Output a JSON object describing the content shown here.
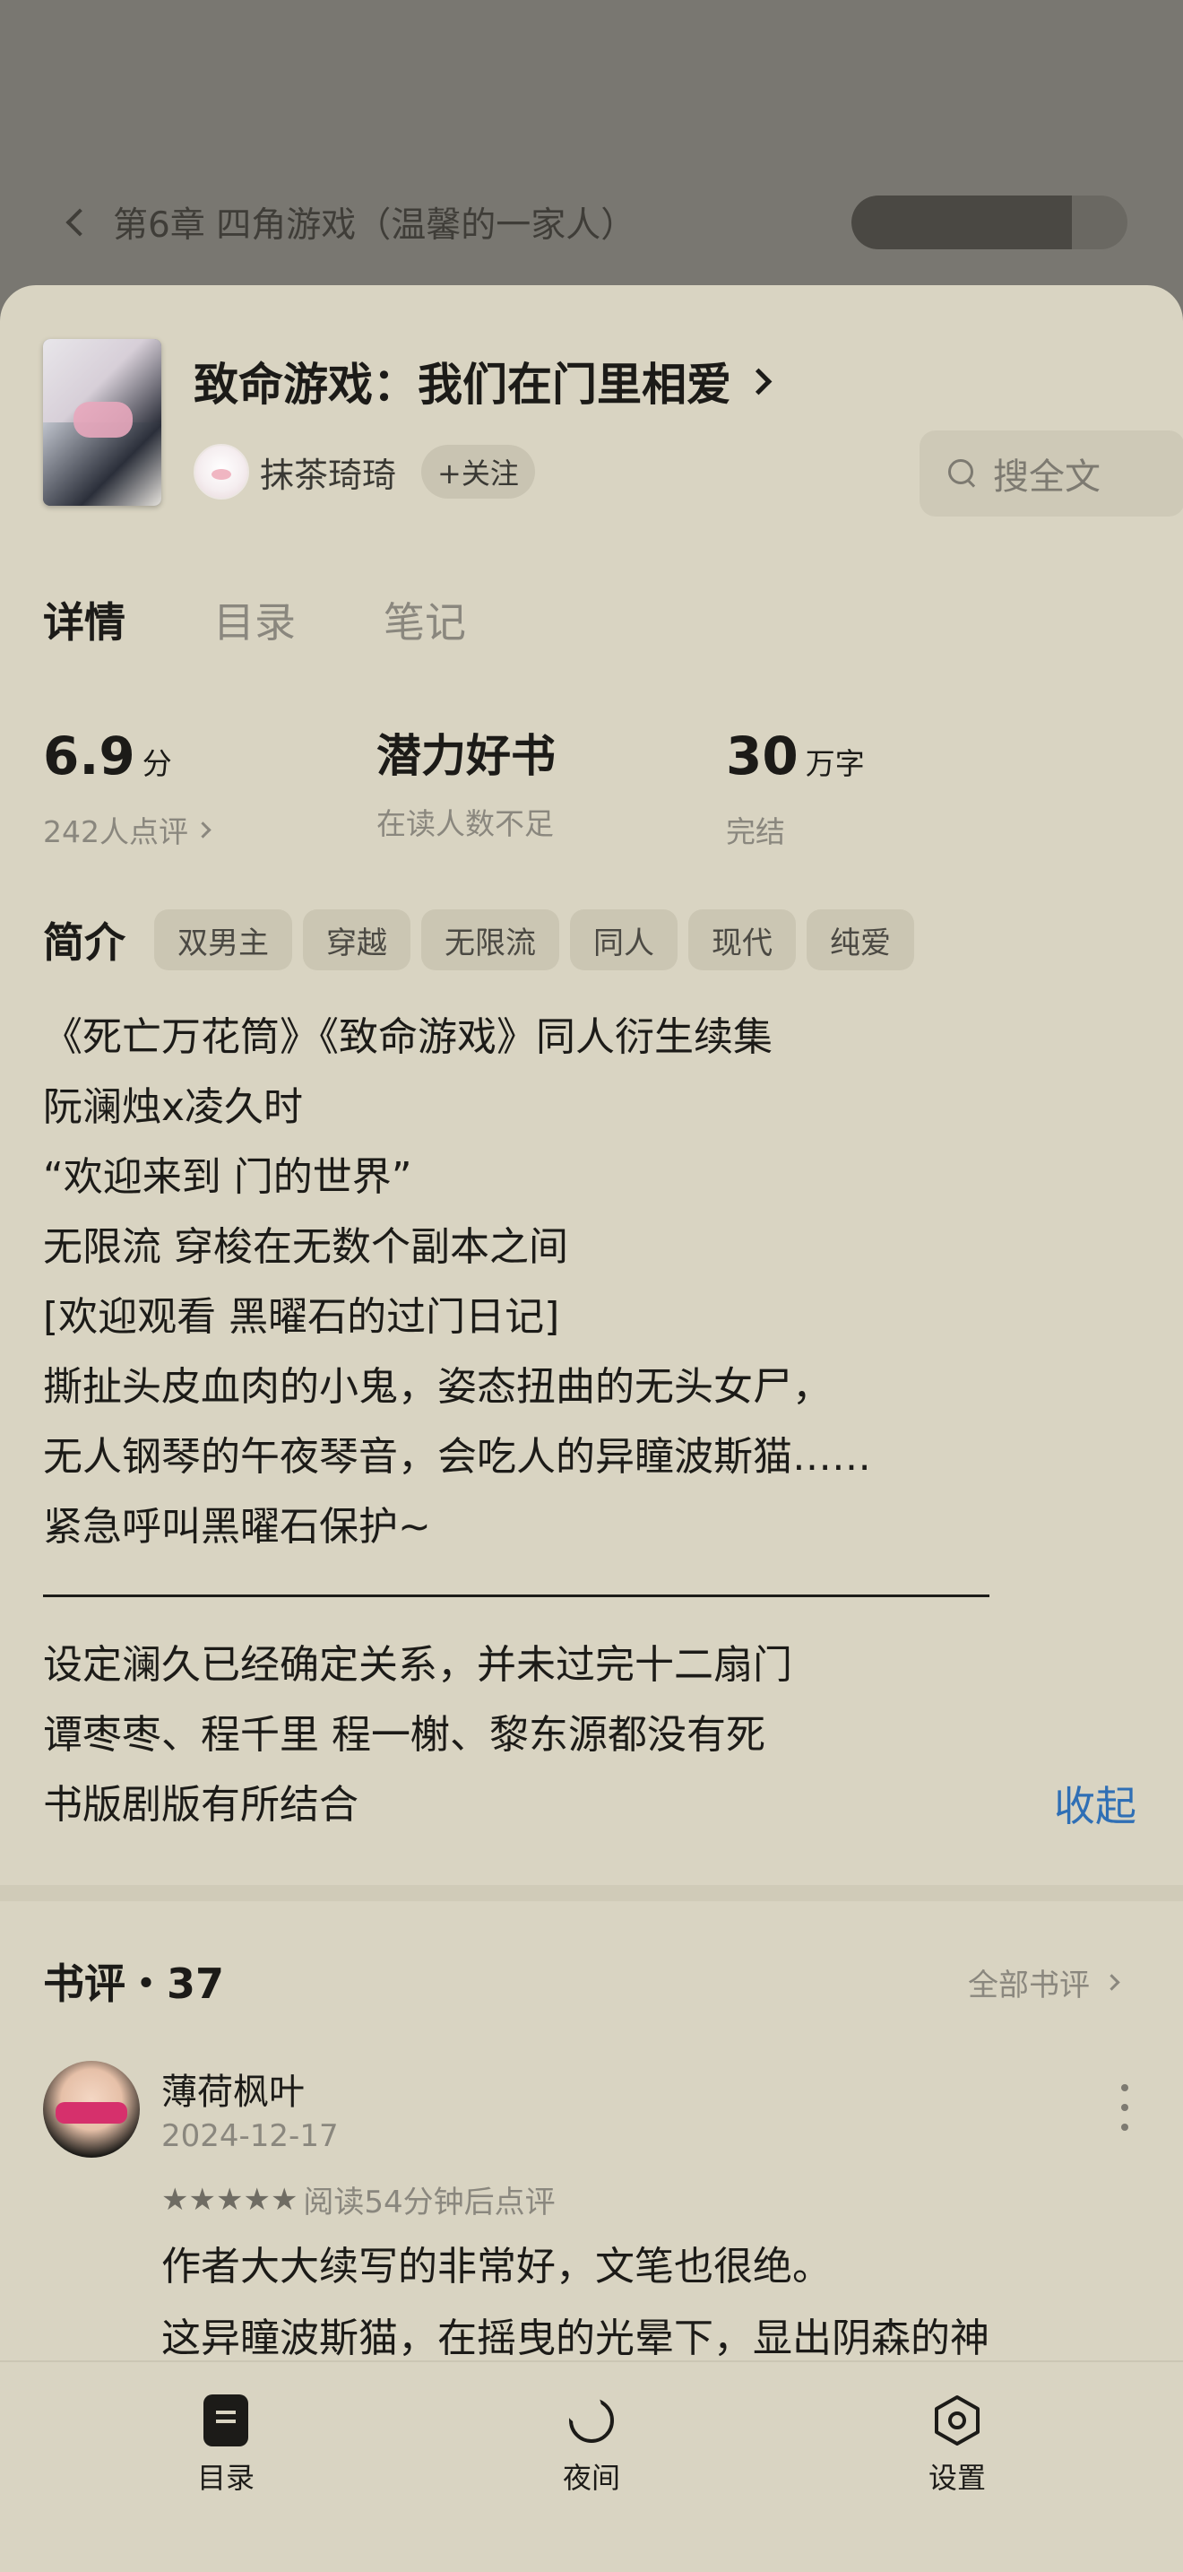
{
  "reader": {
    "chapter_title": "第6章 四角游戏（温馨的一家人）",
    "progress": 0.8
  },
  "book": {
    "title": "致命游戏：我们在门里相爱",
    "author": "抹茶琦琦",
    "follow_label": "+关注",
    "search_label": "搜全文"
  },
  "tabs": [
    "详情",
    "目录",
    "笔记"
  ],
  "stats": {
    "score": "6.9",
    "score_unit": "分",
    "reviews_count_label": "242人点评",
    "potential_label": "潜力好书",
    "potential_sub": "在读人数不足",
    "words": "30",
    "words_unit": "万字",
    "status": "完结"
  },
  "intro": {
    "label": "简介",
    "tags": [
      "双男主",
      "穿越",
      "无限流",
      "同人",
      "现代",
      "纯爱"
    ],
    "lines": [
      "《死亡万花筒》《致命游戏》同人衍生续集",
      "阮澜烛x凌久时",
      "“欢迎来到 门的世界”",
      "无限流 穿梭在无数个副本之间",
      "[欢迎观看 黑曜石的过门日记]",
      "撕扯头皮血肉的小鬼，姿态扭曲的无头女尸，",
      "无人钢琴的午夜琴音，会吃人的异瞳波斯猫……",
      "紧急呼叫黑曜石保护~"
    ],
    "lines_after": [
      "设定澜久已经确定关系，并未过完十二扇门",
      "谭枣枣、程千里 程一榭、黎东源都没有死",
      "书版剧版有所结合"
    ],
    "collapse_label": "收起"
  },
  "reviews": {
    "title": "书评・37",
    "all_label": "全部书评",
    "items": [
      {
        "name": "薄荷枫叶",
        "date": "2024-12-17",
        "stars": 5,
        "meta": "阅读54分钟后点评",
        "text": [
          "作者大大续写的非常好，文笔也很绝。",
          "这异瞳波斯猫，在摇曳的光晕下，显出阴森的神"
        ]
      }
    ]
  },
  "bottom_nav": [
    {
      "label": "目录",
      "icon": "toc-icon"
    },
    {
      "label": "夜间",
      "icon": "moon-icon"
    },
    {
      "label": "设置",
      "icon": "settings-icon"
    }
  ],
  "colors": {
    "sheet_bg": "#d9d4c2",
    "backdrop": "#797771",
    "accent_link": "#2f6fb5"
  }
}
